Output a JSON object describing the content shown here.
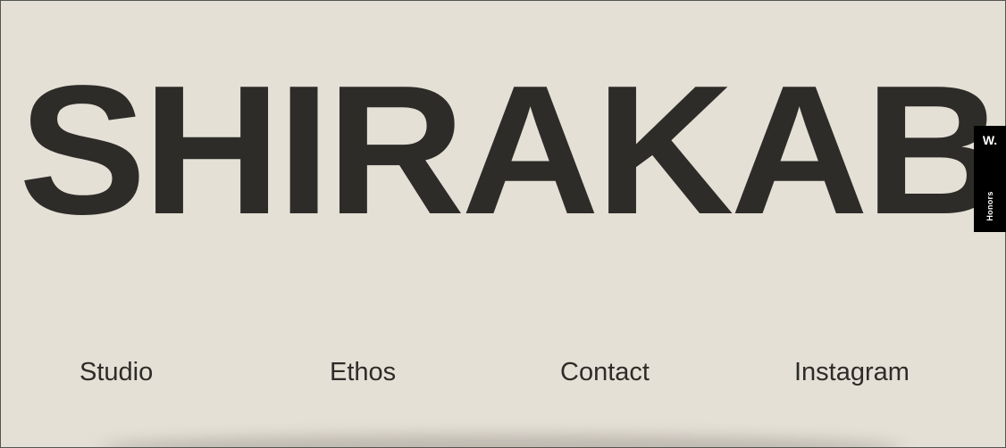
{
  "brand": {
    "wordmark": "SHIRAKABA"
  },
  "nav": {
    "items": [
      {
        "label": "Studio"
      },
      {
        "label": "Ethos"
      },
      {
        "label": "Contact"
      },
      {
        "label": "Instagram"
      }
    ]
  },
  "award_badge": {
    "logo": "W.",
    "label": "Honors"
  },
  "colors": {
    "background": "#e4e0d6",
    "text": "#2e2c28",
    "badge": "#000000"
  }
}
